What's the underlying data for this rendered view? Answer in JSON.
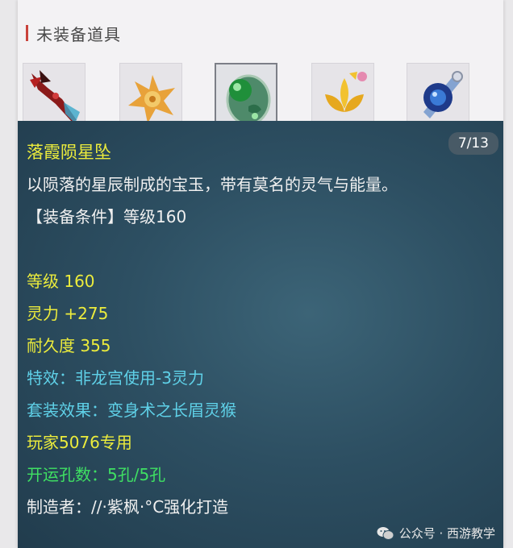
{
  "section": {
    "title": "未装备道具"
  },
  "items": [
    {
      "name": "red-feather-weapon-icon"
    },
    {
      "name": "golden-flower-icon"
    },
    {
      "name": "green-jade-pendant-icon"
    },
    {
      "name": "golden-lotus-icon"
    },
    {
      "name": "blue-gem-icon"
    }
  ],
  "tooltip": {
    "item_name": "落霞陨星坠",
    "counter": "7/13",
    "description": "以陨落的星辰制成的宝玉，带有莫名的灵气与能量。",
    "requirement": "【装备条件】等级160",
    "stats": {
      "level": "等级 160",
      "spirit": "灵力 +275",
      "durability": "耐久度 355"
    },
    "special_effect": "特效：非龙宫使用-3灵力",
    "set_effect": "套装效果：变身术之长眉灵猴",
    "owner": "玩家5076专用",
    "slots": "开运孔数：5孔/5孔",
    "maker": "制造者：//·紫枫·°C强化打造"
  },
  "watermark": {
    "text": "公众号 · 西游教学"
  },
  "colors": {
    "name_yellow": "#ecec3c",
    "effect_cyan": "#5fd1e8",
    "slots_green": "#3fe063",
    "accent_red": "#c9423b"
  }
}
